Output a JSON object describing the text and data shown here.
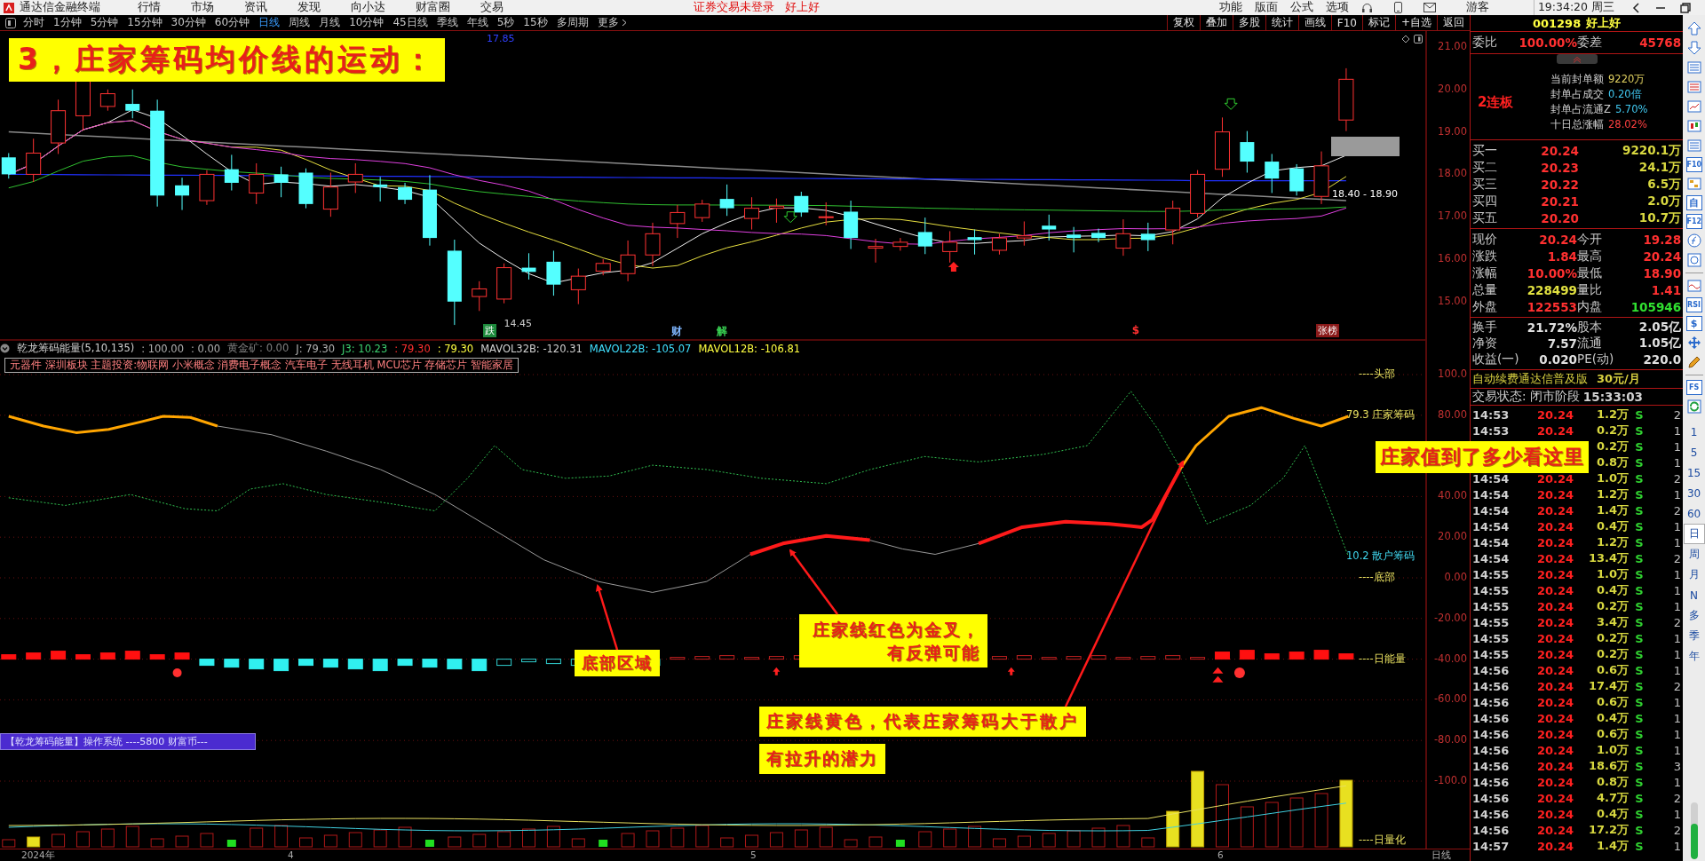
{
  "menu_bar": {
    "app_title": "通达信金融终端",
    "items": [
      "行情",
      "市场",
      "资讯",
      "发现",
      "向小达",
      "财富圈",
      "交易"
    ],
    "notice": "证券交易未登录",
    "stock": "好上好",
    "right_items": [
      "功能",
      "版面",
      "公式",
      "选项"
    ],
    "user": "游客",
    "clock": "19:34:20 周三"
  },
  "period_bar": {
    "periods": [
      {
        "label": "分时",
        "selected": false
      },
      {
        "label": "1分钟",
        "selected": false
      },
      {
        "label": "5分钟",
        "selected": false
      },
      {
        "label": "15分钟",
        "selected": false
      },
      {
        "label": "30分钟",
        "selected": false
      },
      {
        "label": "60分钟",
        "selected": false
      },
      {
        "label": "日线",
        "selected": true
      },
      {
        "label": "周线",
        "selected": false
      },
      {
        "label": "月线",
        "selected": false
      },
      {
        "label": "10分钟",
        "selected": false
      },
      {
        "label": "45日线",
        "selected": false
      },
      {
        "label": "季线",
        "selected": false
      },
      {
        "label": "年线",
        "selected": false
      },
      {
        "label": "5秒",
        "selected": false
      },
      {
        "label": "15秒",
        "selected": false
      },
      {
        "label": "多周期",
        "selected": false
      }
    ],
    "more": "更多",
    "tools": [
      "复权",
      "叠加",
      "多股",
      "统计",
      "画线",
      "F10",
      "标记",
      "+自选",
      "返回"
    ]
  },
  "price_chart": {
    "ma_reading": "17.85",
    "axis_labels": [
      "21.00",
      "20.00",
      "19.00",
      "18.00",
      "17.00",
      "16.00",
      "15.00"
    ],
    "low_mark": "14.45",
    "range_label": "18.40 - 18.90",
    "events": [
      {
        "label": "跌",
        "color": "#1d8a3c"
      },
      {
        "label": "财",
        "color": "#7fb6ff"
      },
      {
        "label": "解",
        "color": "#39d353"
      },
      {
        "label": "$",
        "color": "#ff3030"
      },
      {
        "label": "张榜",
        "color": "#8a1a1a"
      }
    ]
  },
  "indicator": {
    "name": "乾龙筹码能量(5,10,135)",
    "readings": [
      {
        "text": ": 100.00",
        "color": "#b0b0b0"
      },
      {
        "text": ": 0.00",
        "color": "#b0b0b0"
      },
      {
        "text": "黄金矿: 0.00",
        "color": "#808080"
      },
      {
        "text": "J: 79.30",
        "color": "#b0b0b0"
      },
      {
        "text": "J3: 10.23",
        "color": "#3cd070"
      },
      {
        "text": ": 79.30",
        "color": "#ff3030"
      },
      {
        "text": ": 79.30",
        "color": "#ffff40"
      },
      {
        "text": "MAVOL32B: -120.31",
        "color": "#d0d0d0"
      },
      {
        "text": "MAVOL22B: -105.07",
        "color": "#40e0ff"
      },
      {
        "text": "MAVOL12B: -106.81",
        "color": "#ffff40"
      }
    ],
    "sectors": "元器件 深圳板块 主题投资:物联网 小米概念 消费电子概念 汽车电子 无线耳机 MCU芯片 存储芯片 智能家居",
    "axis_labels": [
      "100.0",
      "80.00",
      "40.00",
      "20.00",
      "0.00",
      "-20.00",
      "-40.00",
      "-60.00",
      "-80.00",
      "-100.0"
    ],
    "line_labels": [
      {
        "text": "----头部",
        "color": "#e8e060"
      },
      {
        "text": "79.3 庄家筹码",
        "color": "#e8e060"
      },
      {
        "text": "10.2 散户筹码",
        "color": "#40d8f0"
      },
      {
        "text": "----底部",
        "color": "#e8e060"
      },
      {
        "text": "----日能量",
        "color": "#e8e060"
      },
      {
        "text": "----日量化",
        "color": "#e8e060"
      }
    ],
    "promo": "【乾龙筹码能量】操作系统 ----5800 财富币---"
  },
  "annotations": [
    "3，庄家筹码均价线的运动：",
    "庄家值到了多少看这里",
    "底部区域",
    "庄家线红色为金叉，有反弹可能",
    "庄家线黄色，代表庄家筹码大于散户",
    "有拉升的潜力"
  ],
  "date_axis": {
    "labels": [
      "2024年",
      "4",
      "5",
      "6"
    ],
    "period": "日线"
  },
  "quote_panel": {
    "code": "001298",
    "name": "好上好",
    "ratio_label": "委比",
    "ratio": "100.00%",
    "diff_label": "委差",
    "diff": "45768",
    "streak": "2连板",
    "seal_items": [
      {
        "label": "当前封单额",
        "value": "9220万",
        "color": "#e0d060"
      },
      {
        "label": "封单占成交",
        "value": "0.20倍",
        "color": "#40c8f0"
      },
      {
        "label": "封单占流通Z",
        "value": "5.70%",
        "color": "#40c8f0"
      },
      {
        "label": "十日总涨幅",
        "value": "28.02%",
        "color": "#ff4040"
      }
    ],
    "bids": [
      {
        "label": "买一",
        "price": "20.24",
        "volume": "9220.1万"
      },
      {
        "label": "买二",
        "price": "20.23",
        "volume": "24.1万"
      },
      {
        "label": "买三",
        "price": "20.22",
        "volume": "6.5万"
      },
      {
        "label": "买四",
        "price": "20.21",
        "volume": "2.0万"
      },
      {
        "label": "买五",
        "price": "20.20",
        "volume": "10.7万"
      }
    ],
    "stats": [
      {
        "label": "现价",
        "value": "20.24",
        "color": "#ff3030"
      },
      {
        "label": "今开",
        "value": "19.28",
        "color": "#ff3030"
      },
      {
        "label": "涨跌",
        "value": "1.84",
        "color": "#ff3030"
      },
      {
        "label": "最高",
        "value": "20.24",
        "color": "#ff3030"
      },
      {
        "label": "涨幅",
        "value": "10.00%",
        "color": "#ff3030"
      },
      {
        "label": "最低",
        "value": "18.90",
        "color": "#ff3030"
      },
      {
        "label": "总量",
        "value": "228499",
        "color": "#e0e040"
      },
      {
        "label": "量比",
        "value": "1.41",
        "color": "#ff3030"
      },
      {
        "label": "外盘",
        "value": "122553",
        "color": "#ff3030"
      },
      {
        "label": "内盘",
        "value": "105946",
        "color": "#30e030"
      }
    ],
    "fundamentals": [
      {
        "label": "换手",
        "value": "21.72%"
      },
      {
        "label": "股本",
        "value": "2.05亿"
      },
      {
        "label": "净资",
        "value": "7.57"
      },
      {
        "label": "流通",
        "value": "1.05亿"
      },
      {
        "label": "收益(一)",
        "value": "0.020"
      },
      {
        "label": "PE(动)",
        "value": "220.0"
      }
    ],
    "ad": {
      "text": "自动续费通达信普及版",
      "price": "30元/月"
    },
    "status": {
      "label": "交易状态: 闭市阶段",
      "time": "15:33:03"
    },
    "ticks": [
      {
        "time": "14:53",
        "price": "20.24",
        "volume": "1.2万",
        "side": "S",
        "count": "2"
      },
      {
        "time": "14:53",
        "price": "20.24",
        "volume": "0.2万",
        "side": "S",
        "count": "1"
      },
      {
        "volume": "0.2万",
        "side": "S",
        "count": "1"
      },
      {
        "volume": "0.8万",
        "side": "S",
        "count": "1"
      },
      {
        "time": "14:54",
        "price": "20.24",
        "volume": "1.0万",
        "side": "S",
        "count": "2"
      },
      {
        "time": "14:54",
        "price": "20.24",
        "volume": "1.2万",
        "side": "S",
        "count": "1"
      },
      {
        "time": "14:54",
        "price": "20.24",
        "volume": "1.4万",
        "side": "S",
        "count": "2"
      },
      {
        "time": "14:54",
        "price": "20.24",
        "volume": "0.4万",
        "side": "S",
        "count": "1"
      },
      {
        "time": "14:54",
        "price": "20.24",
        "volume": "1.2万",
        "side": "S",
        "count": "1"
      },
      {
        "time": "14:54",
        "price": "20.24",
        "volume": "13.4万",
        "side": "S",
        "count": "2"
      },
      {
        "time": "14:55",
        "price": "20.24",
        "volume": "1.0万",
        "side": "S",
        "count": "1"
      },
      {
        "time": "14:55",
        "price": "20.24",
        "volume": "0.4万",
        "side": "S",
        "count": "1"
      },
      {
        "time": "14:55",
        "price": "20.24",
        "volume": "0.2万",
        "side": "S",
        "count": "1"
      },
      {
        "time": "14:55",
        "price": "20.24",
        "volume": "3.4万",
        "side": "S",
        "count": "2"
      },
      {
        "time": "14:55",
        "price": "20.24",
        "volume": "0.2万",
        "side": "S",
        "count": "1"
      },
      {
        "time": "14:55",
        "price": "20.24",
        "volume": "0.2万",
        "side": "S",
        "count": "1"
      },
      {
        "time": "14:56",
        "price": "20.24",
        "volume": "0.6万",
        "side": "S",
        "count": "1"
      },
      {
        "time": "14:56",
        "price": "20.24",
        "volume": "17.4万",
        "side": "S",
        "count": "2"
      },
      {
        "time": "14:56",
        "price": "20.24",
        "volume": "0.6万",
        "side": "S",
        "count": "1"
      },
      {
        "time": "14:56",
        "price": "20.24",
        "volume": "0.4万",
        "side": "S",
        "count": "1"
      },
      {
        "time": "14:56",
        "price": "20.24",
        "volume": "0.6万",
        "side": "S",
        "count": "1"
      },
      {
        "time": "14:56",
        "price": "20.24",
        "volume": "1.0万",
        "side": "S",
        "count": "1"
      },
      {
        "time": "14:56",
        "price": "20.24",
        "volume": "18.6万",
        "side": "S",
        "count": "3"
      },
      {
        "time": "14:56",
        "price": "20.24",
        "volume": "0.8万",
        "side": "S",
        "count": "1"
      },
      {
        "time": "14:56",
        "price": "20.24",
        "volume": "4.7万",
        "side": "S",
        "count": "2"
      },
      {
        "time": "14:56",
        "price": "20.24",
        "volume": "0.4万",
        "side": "S",
        "count": "1"
      },
      {
        "time": "14:56",
        "price": "20.24",
        "volume": "17.2万",
        "side": "S",
        "count": "2"
      },
      {
        "time": "14:57",
        "price": "20.24",
        "volume": "1.4万",
        "side": "S",
        "count": "1"
      }
    ]
  },
  "side_toolbar": {
    "tool_labels": [
      "F10",
      "自",
      "F12",
      "RSI",
      "$",
      "FS"
    ],
    "periods": [
      {
        "label": "1",
        "selected": false
      },
      {
        "label": "5",
        "selected": false
      },
      {
        "label": "15",
        "selected": false
      },
      {
        "label": "30",
        "selected": false
      },
      {
        "label": "60",
        "selected": false
      },
      {
        "label": "日",
        "selected": true
      },
      {
        "label": "周",
        "selected": false
      },
      {
        "label": "月",
        "selected": false
      },
      {
        "label": "N",
        "selected": false
      },
      {
        "label": "多",
        "selected": false
      },
      {
        "label": "季",
        "selected": false
      },
      {
        "label": "年",
        "selected": false
      }
    ]
  }
}
